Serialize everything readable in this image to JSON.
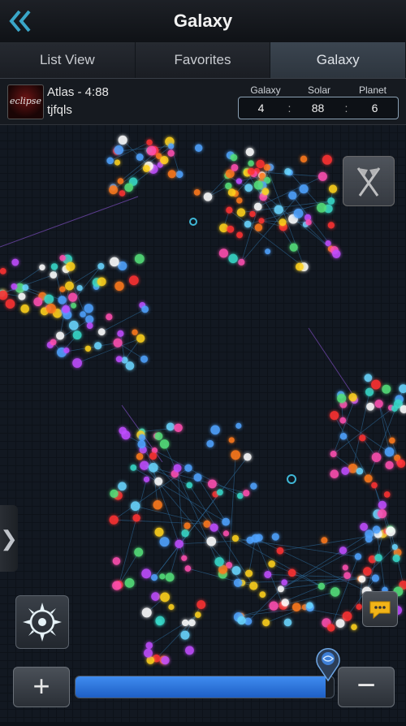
{
  "header": {
    "title": "Galaxy"
  },
  "tabs": [
    {
      "label": "List View",
      "active": false
    },
    {
      "label": "Favorites",
      "active": false
    },
    {
      "label": "Galaxy",
      "active": true
    }
  ],
  "location": {
    "avatar_text": "eclipse",
    "name": "Atlas - 4:88",
    "user": "tjfqls"
  },
  "coordinates": {
    "labels": {
      "galaxy": "Galaxy",
      "solar": "Solar",
      "planet": "Planet"
    },
    "galaxy": "4",
    "solar": "88",
    "planet": "6",
    "separator": ":"
  },
  "controls": {
    "plus_label": "+",
    "minus_label": "−",
    "side_arrow": "❯",
    "zoom_level": 0.97
  },
  "colors": {
    "accent": "#2f7be0",
    "background": "#0c1118",
    "node_colors": [
      "#4fa3ff",
      "#ff3333",
      "#ffd21f",
      "#55e07a",
      "#ff7a1f",
      "#c04dff",
      "#39d9c9",
      "#ff4fb0",
      "#ffffff",
      "#6ad6ff"
    ]
  },
  "icons": {
    "back": "double-chevron-left-icon",
    "battle": "crossed-flags-icon",
    "compass": "compass-icon",
    "chat": "chat-bubble-icon",
    "galaxy_marker": "galaxy-pin-icon"
  }
}
